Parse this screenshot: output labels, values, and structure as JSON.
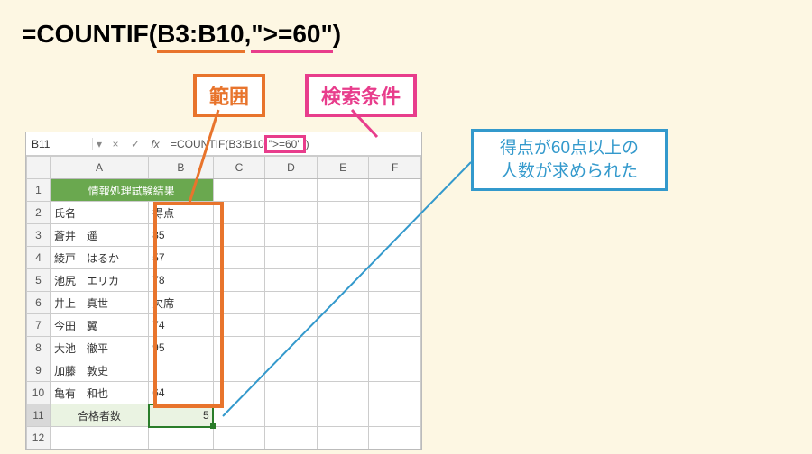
{
  "formula": {
    "prefix": "=COUNTIF(",
    "range": "B3:B10",
    "sep": ",",
    "condition": "\">=60\"",
    "suffix": ")"
  },
  "labels": {
    "range": "範囲",
    "condition": "検索条件"
  },
  "result_note": {
    "line1": "得点が60点以上の",
    "line2": "人数が求められた"
  },
  "fx": {
    "cell_ref": "B11",
    "x_btn": "×",
    "check_btn": "✓",
    "fx_label": "fx",
    "prefix": "=COUNTIF(B3:B10",
    "cond": "\">=60\"",
    "suffix": ")"
  },
  "cols": [
    "A",
    "B",
    "C",
    "D",
    "E",
    "F"
  ],
  "table": {
    "title": "情報処理試験結果",
    "header": {
      "name": "氏名",
      "score": "得点"
    },
    "rows": [
      {
        "name": "蒼井　遥",
        "score": "85"
      },
      {
        "name": "綾戸　はるか",
        "score": "57"
      },
      {
        "name": "池尻　エリカ",
        "score": "78"
      },
      {
        "name": "井上　真世",
        "score": "欠席"
      },
      {
        "name": "今田　翼",
        "score": "74"
      },
      {
        "name": "大池　徹平",
        "score": "95"
      },
      {
        "name": "加藤　敦史",
        "score": ""
      },
      {
        "name": "亀有　和也",
        "score": "64"
      }
    ],
    "footer": {
      "label": "合格者数",
      "value": "5"
    }
  }
}
